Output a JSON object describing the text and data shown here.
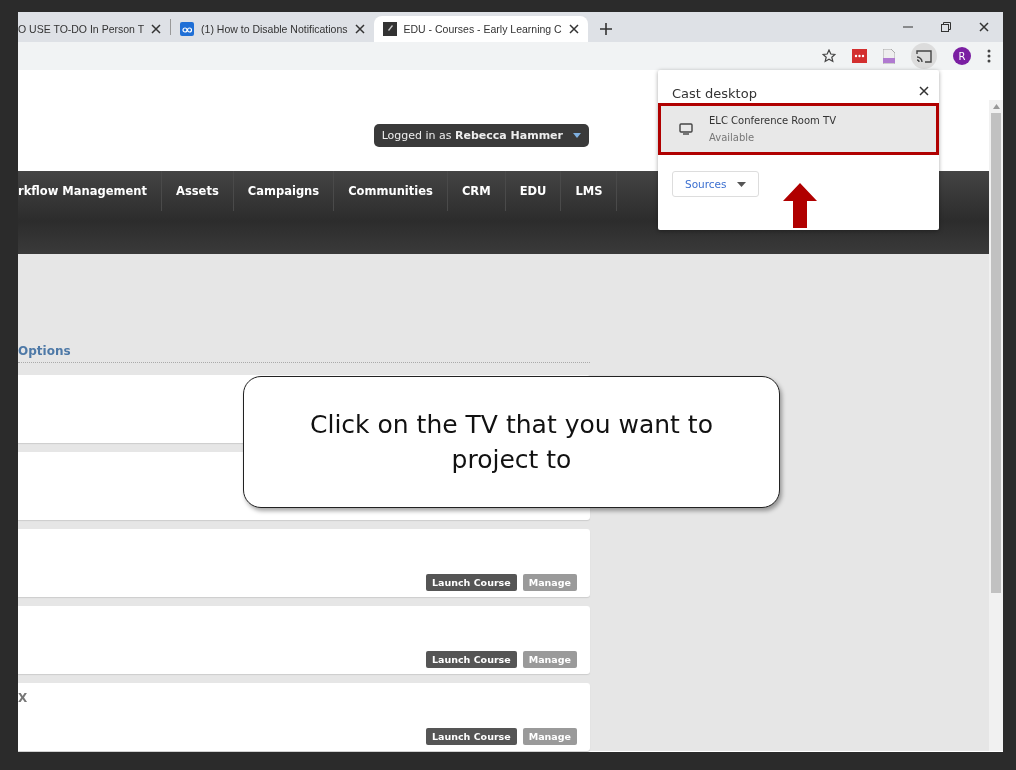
{
  "tabs": [
    {
      "title": "O USE TO-DO In Person T",
      "kind": "plain",
      "selected": false
    },
    {
      "title": "(1) How to Disable Notifications",
      "kind": "box",
      "selected": false
    },
    {
      "title": "EDU - Courses - Early Learning C",
      "kind": "dark",
      "selected": true
    }
  ],
  "toolbar": {
    "avatar": "R",
    "cast_active": true
  },
  "header": {
    "login": "Logged in as **Rebecca Hammer**"
  },
  "nav": [
    "rkflow Management",
    "Assets",
    "Campaigns",
    "Communities",
    "CRM",
    "EDU",
    "LMS"
  ],
  "section_heading": "Options",
  "courses": [
    {
      "kind": "course"
    },
    {
      "kind": "course"
    },
    {
      "kind": "course",
      "buttons": [
        "Launch Course",
        "Manage"
      ]
    },
    {
      "kind": "course",
      "buttons": [
        "Launch Course",
        "Manage"
      ]
    },
    {
      "kind": "course",
      "title": "X",
      "buttons": [
        "Launch Course",
        "Manage"
      ]
    }
  ],
  "cast_popup": {
    "title": "Cast desktop",
    "devices": [
      {
        "name": "ELC Conference Room TV",
        "status": "Available",
        "highlighted": true
      }
    ],
    "sources_button": "Sources"
  },
  "callout": {
    "text": "Click on the TV that you want to project to"
  }
}
